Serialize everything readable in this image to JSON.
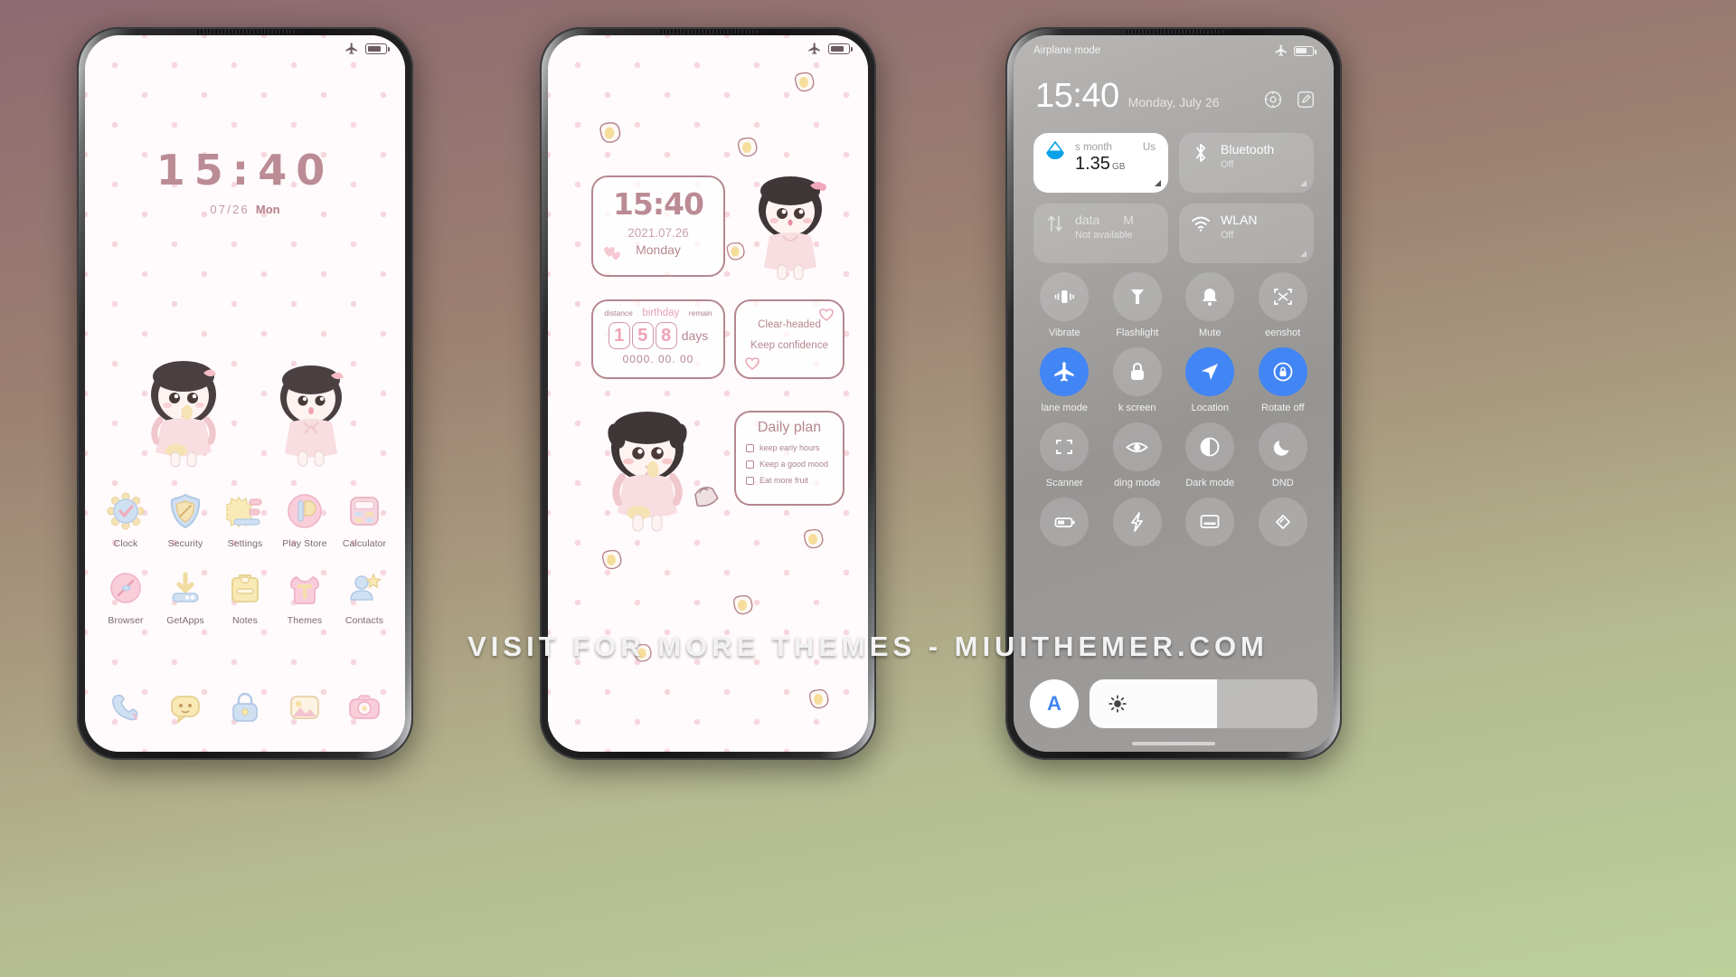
{
  "wallpaper": {
    "dot_color": "#f6d7dd",
    "bg_color": "#fffafb"
  },
  "accent": {
    "pink": "#b5878f",
    "pink_light": "#eda3b6",
    "blue": "#4285f4"
  },
  "watermark": {
    "text": "VISIT  FOR  MORE  THEMES  -  MIUITHEMER.COM"
  },
  "lockscreen": {
    "time": "15:40",
    "date": "07/26",
    "weekday": "Mon",
    "status": {
      "airplane_icon": "airplane-icon",
      "battery_icon": "battery-icon"
    }
  },
  "homescreen": {
    "rows": [
      [
        {
          "label": "Clock",
          "icon": "clock-icon"
        },
        {
          "label": "Security",
          "icon": "shield-icon"
        },
        {
          "label": "Settings",
          "icon": "settings-icon"
        },
        {
          "label": "Play Store",
          "icon": "play-store-icon"
        },
        {
          "label": "Calculator",
          "icon": "calculator-icon"
        }
      ],
      [
        {
          "label": "Browser",
          "icon": "browser-icon"
        },
        {
          "label": "GetApps",
          "icon": "getapps-icon"
        },
        {
          "label": "Notes",
          "icon": "notes-icon"
        },
        {
          "label": "Themes",
          "icon": "themes-icon"
        },
        {
          "label": "Contacts",
          "icon": "contacts-icon"
        }
      ]
    ],
    "dock": [
      {
        "label": "Phone",
        "icon": "phone-icon"
      },
      {
        "label": "Messages",
        "icon": "messages-icon"
      },
      {
        "label": "Security Lock",
        "icon": "lock-icon"
      },
      {
        "label": "Gallery",
        "icon": "gallery-icon"
      },
      {
        "label": "Camera",
        "icon": "camera-icon"
      }
    ]
  },
  "widgets": {
    "clock": {
      "time": "15:40",
      "date": "2021.07.26",
      "day": "Monday"
    },
    "birthday": {
      "label_left": "distance",
      "label_mid": "birthday",
      "label_right": "remain",
      "digits": [
        "1",
        "5",
        "8"
      ],
      "unit": "days",
      "sub": "0000. 00. 00"
    },
    "quote": {
      "line1": "Clear-headed",
      "line2": "Keep confidence"
    },
    "plan": {
      "title": "Daily plan",
      "items": [
        "keep early hours",
        "Keep a good mood",
        "Eat more fruit"
      ]
    }
  },
  "control_center": {
    "status_label": "Airplane mode",
    "time": "15:40",
    "date": "Monday, July 26",
    "actions": [
      {
        "name": "settings-gear-icon"
      },
      {
        "name": "edit-icon"
      }
    ],
    "cards": [
      {
        "type": "data",
        "top_left": "s month",
        "top_right": "Us",
        "value": "1.35",
        "unit": "GB",
        "icon": "data-drop-icon",
        "light": true
      },
      {
        "type": "toggle",
        "title": "Bluetooth",
        "sub": "Off",
        "icon": "bluetooth-icon"
      },
      {
        "type": "toggle",
        "title": "data",
        "title2": "M",
        "sub": "Not available",
        "icon": "mobile-data-icon"
      },
      {
        "type": "toggle",
        "title": "WLAN",
        "sub": "Off",
        "icon": "wifi-icon"
      }
    ],
    "toggles": [
      {
        "label": "Vibrate",
        "icon": "vibrate-icon",
        "on": false
      },
      {
        "label": "Flashlight",
        "icon": "flashlight-icon",
        "on": false
      },
      {
        "label": "Mute",
        "icon": "bell-icon",
        "on": false
      },
      {
        "label": "eenshot",
        "icon": "screenshot-icon",
        "on": false
      },
      {
        "label": "lane mode",
        "icon": "airplane-icon",
        "on": true
      },
      {
        "label": "k screen",
        "icon": "lock-icon",
        "on": false
      },
      {
        "label": "Location",
        "icon": "location-icon",
        "on": true
      },
      {
        "label": "Rotate off",
        "icon": "rotate-lock-icon",
        "on": true
      },
      {
        "label": "Scanner",
        "icon": "scanner-icon",
        "on": false
      },
      {
        "label": "ding mode",
        "icon": "eye-icon",
        "on": false
      },
      {
        "label": "Dark mode",
        "icon": "contrast-icon",
        "on": false
      },
      {
        "label": "DND",
        "icon": "moon-icon",
        "on": false
      },
      {
        "label": "",
        "icon": "battery-saver-icon",
        "on": false
      },
      {
        "label": "",
        "icon": "bolt-icon",
        "on": false
      },
      {
        "label": "",
        "icon": "cast-icon",
        "on": false
      },
      {
        "label": "",
        "icon": "nfc-icon",
        "on": false
      }
    ],
    "brightness": {
      "auto_label": "A",
      "sun_icon": "sun-icon",
      "level": 56
    }
  }
}
